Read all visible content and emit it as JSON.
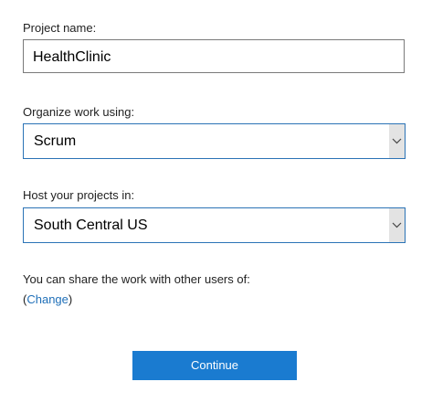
{
  "project_name": {
    "label": "Project name:",
    "value": "HealthClinic"
  },
  "organize": {
    "label": "Organize work using:",
    "selected": "Scrum"
  },
  "host": {
    "label": "Host your projects in:",
    "selected": "South Central US"
  },
  "share": {
    "text": "You can share the work with other users of:",
    "open_paren": "(",
    "link": "Change",
    "close_paren": ")"
  },
  "continue_button": {
    "label": "Continue"
  },
  "colors": {
    "accent": "#1a7bd0",
    "link": "#1f6fb8",
    "select_border": "#2b73b6"
  },
  "icons": {
    "dropdown": "chevron-down-icon"
  }
}
